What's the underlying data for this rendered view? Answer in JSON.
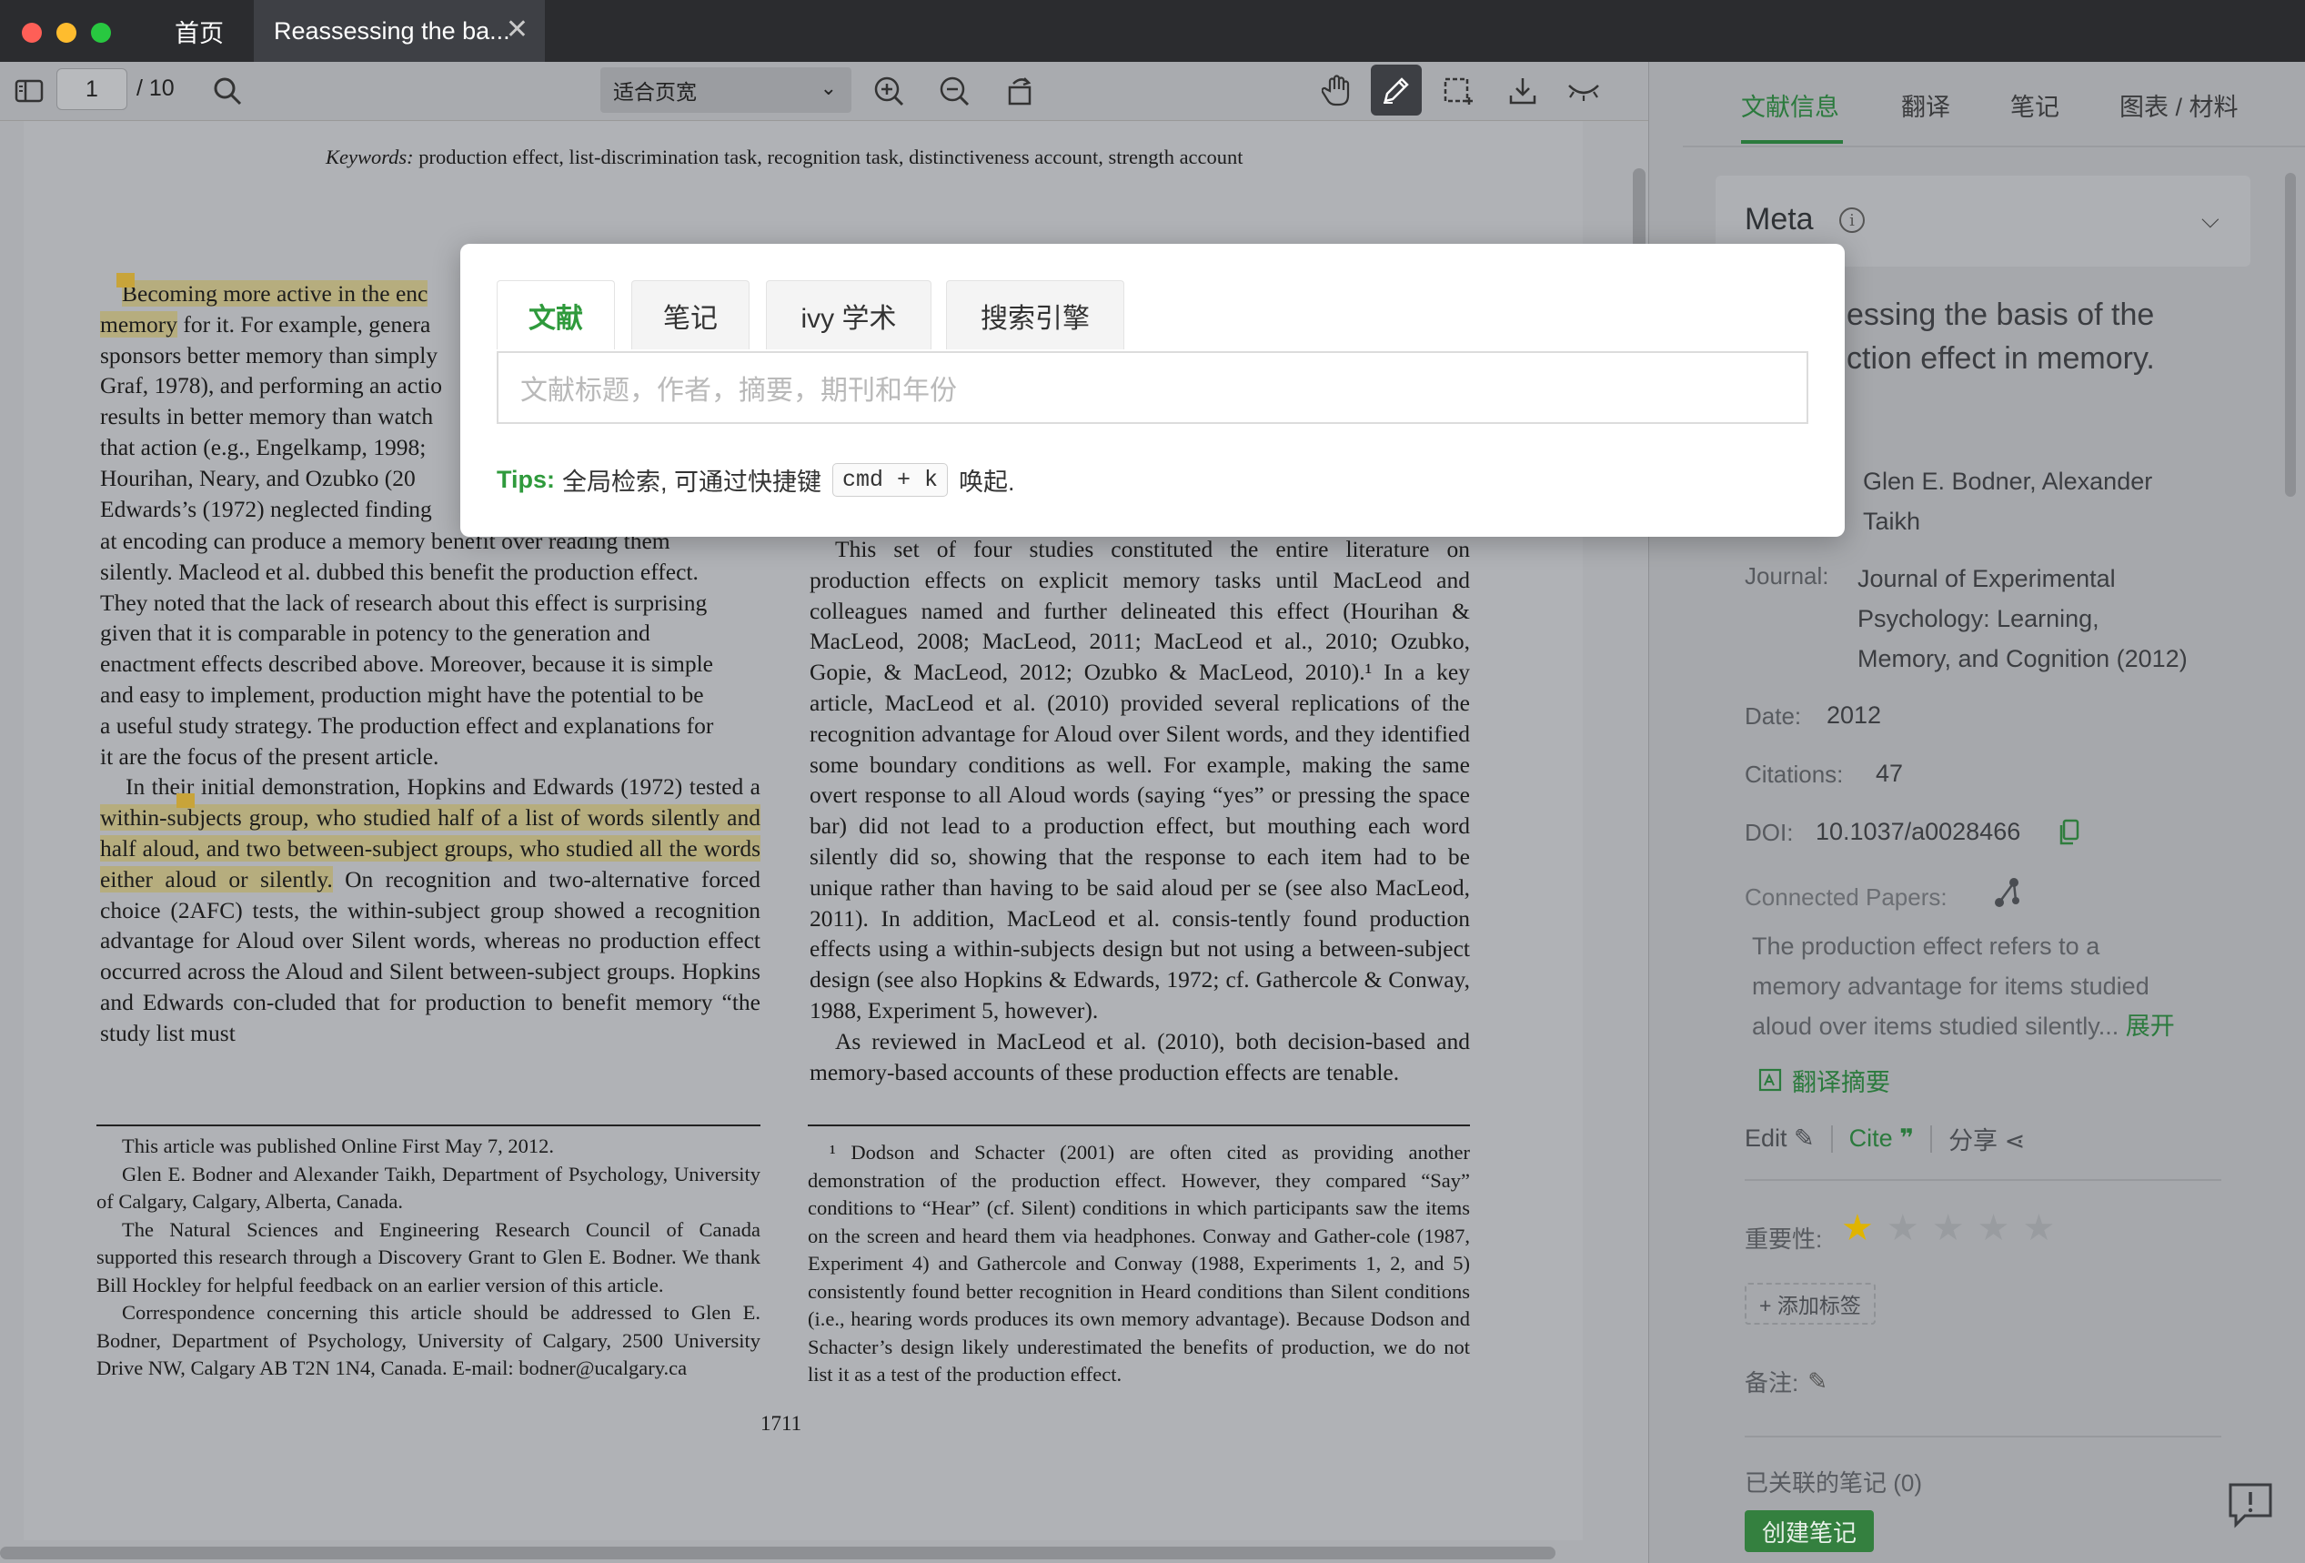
{
  "tabs": {
    "home": "首页",
    "doc": "Reassessing the ba..."
  },
  "toolbar": {
    "page_current": "1",
    "page_total": "/ 10",
    "zoom": "适合页宽"
  },
  "document": {
    "keywords_label": "Keywords:",
    "keywords_text": " production effect, list-discrimination task, recognition task, distinctiveness account, strength account",
    "col1": [
      {
        "hl": "Becoming more active in the enc",
        "text": ""
      },
      {
        "hl": "memory",
        "text": " for it. For example, genera"
      },
      "sponsors better memory than simply",
      "Graf, 1978), and performing an actio",
      "results in better memory than watch",
      "that action (e.g., Engelkamp, 1998;",
      "Hourihan, Neary, and Ozubko (20",
      "Edwards’s (1972) neglected finding"
    ],
    "col1_body": [
      "at encoding can produce a memory benefit over reading them",
      "silently. Macleod et al. dubbed this benefit the production effect.",
      "They noted that the lack of research about this effect is surprising",
      "given that it is comparable in potency to the generation and",
      "enactment effects described above. Moreover, because it is simple",
      "and easy to implement, production might have the potential to be",
      "a useful study strategy. The production effect and explanations for",
      "it are the focus of the present article."
    ],
    "col1_para2_start": "In their initial demonstration, Hopkins and Edwards (1972)",
    "col1_para2_tested": "tested a ",
    "col1_para2_hl": "within-subjects group, who studied half of a list of words silently and half aloud, and two between-subject groups, who studied all the words either aloud or silently.",
    "col1_para2_rest": " On recognition and two-alternative forced choice (2AFC) tests, the within-subject group showed a recognition advantage for Aloud over Silent words, whereas no production effect occurred across the Aloud and Silent between-subject groups. Hopkins and Edwards con-cluded that for production to benefit memory “the study list must",
    "col2_body": "This set of four studies constituted the entire literature on production effects on explicit memory tasks until MacLeod and colleagues named and further delineated this effect (Hourihan & MacLeod, 2008; MacLeod, 2011; MacLeod et al., 2010; Ozubko, Gopie, & MacLeod, 2012; Ozubko & MacLeod, 2010).¹ In a key article, MacLeod et al. (2010) provided several replications of the recognition advantage for Aloud over Silent words, and they identified some boundary conditions as well. For example, making the same overt response to all Aloud words (saying “yes” or pressing the space bar) did not lead to a production effect, but mouthing each word silently did so, showing that the response to each item had to be unique rather than having to be said aloud per se (see also MacLeod, 2011). In addition, MacLeod et al. consis-tently found production effects using a within-subjects design but not using a between-subject design (see also Hopkins & Edwards, 1972; cf. Gathercole & Conway, 1988, Experiment 5, however).",
    "col2_para2": "As reviewed in MacLeod et al. (2010), both decision-based and memory-based accounts of these production effects are tenable.",
    "foot1": [
      "This article was published Online First May 7, 2012.",
      "Glen E. Bodner and Alexander Taikh, Department of Psychology, University of Calgary, Calgary, Alberta, Canada.",
      "The Natural Sciences and Engineering Research Council of Canada supported this research through a Discovery Grant to Glen E. Bodner. We thank Bill Hockley for helpful feedback on an earlier version of this article.",
      "Correspondence concerning this article should be addressed to Glen E. Bodner, Department of Psychology, University of Calgary, 2500 University Drive NW, Calgary AB T2N 1N4, Canada. E-mail: bodner@ucalgary.ca"
    ],
    "foot2": "¹ Dodson and Schacter (2001) are often cited as providing another demonstration of the production effect. However, they compared “Say” conditions to “Hear” (cf. Silent) conditions in which participants saw the items on the screen and heard them via headphones. Conway and Gather-cole (1987, Experiment 4) and Gathercole and Conway (1988, Experiments 1, 2, and 5) consistently found better recognition in Heard conditions than Silent conditions (i.e., hearing words produces its own memory advantage). Because Dodson and Schacter’s design likely underestimated the benefits of production, we do not list it as a test of the production effect.",
    "page_number": "1711"
  },
  "panel": {
    "tabs": [
      "文献信息",
      "翻译",
      "笔记",
      "图表 / 材料"
    ],
    "meta_title": "Meta",
    "title_line1": "essing the basis of the",
    "title_line2": "ction effect in memory.",
    "authors_line1": "Glen E. Bodner, Alexander",
    "authors_line2": "Taikh",
    "journal_label": "Journal:",
    "journal_line1": "Journal of Experimental",
    "journal_line2": "Psychology: Learning,",
    "journal_line3": "Memory, and Cognition (2012)",
    "date_label": "Date:",
    "date_value": "2012",
    "citations_label": "Citations:",
    "citations_value": "47",
    "doi_label": "DOI:",
    "doi_value": "10.1037/a0028466",
    "connected_label": "Connected Papers:",
    "abstract_line1": "The production effect refers to a",
    "abstract_line2": "memory advantage for items studied",
    "abstract_line3": "aloud over items studied silently...",
    "expand": "展开",
    "translate_abstract": "翻译摘要",
    "edit": "Edit",
    "cite": "Cite",
    "share": "分享",
    "importance_label": "重要性:",
    "rating": 1,
    "rating_max": 5,
    "add_tag": "+ 添加标签",
    "note_label": "备注:",
    "linked_notes": "已关联的笔记 (0)",
    "create_note": "创建笔记"
  },
  "modal": {
    "tabs": [
      "文献",
      "笔记",
      "ivy 学术",
      "搜索引擎"
    ],
    "search_placeholder": "文献标题，作者，摘要，期刊和年份",
    "tips_label": "Tips:",
    "tips_text": "全局检索, 可通过快捷键",
    "tips_kbd": "cmd + k",
    "tips_suffix": "唤起."
  },
  "colors": {
    "accent": "#2f9a3c",
    "star": "#e0b400",
    "highlight": "#b6ad7e"
  }
}
